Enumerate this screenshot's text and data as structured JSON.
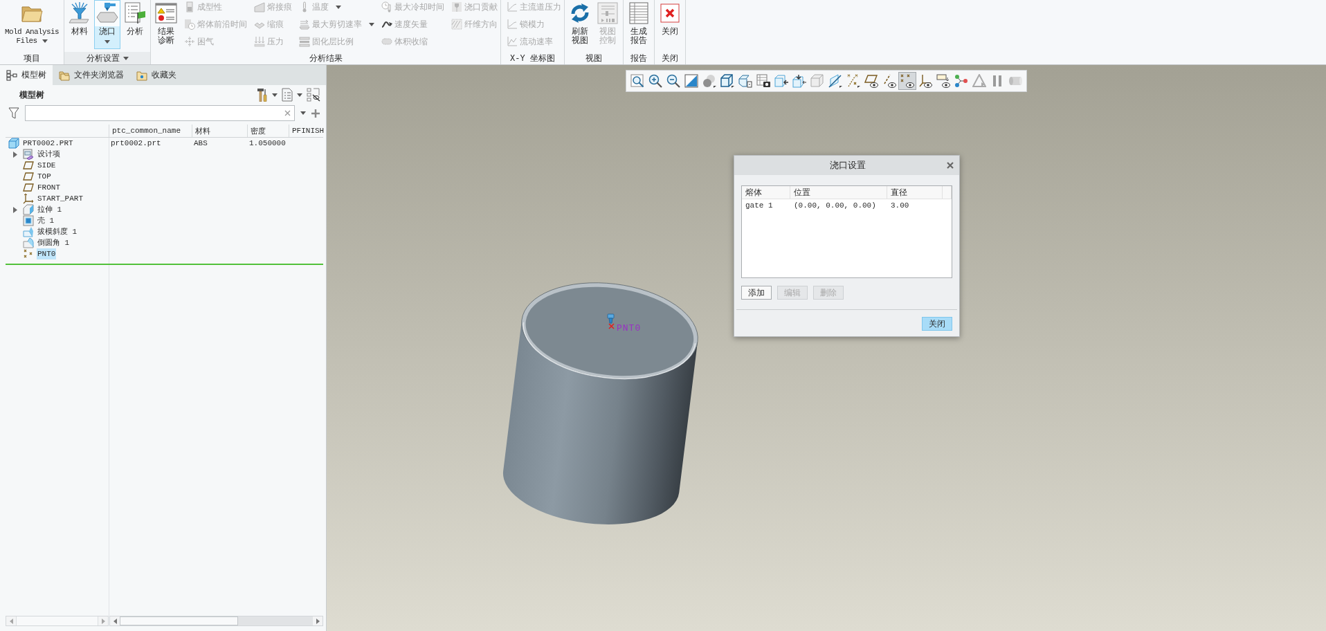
{
  "ribbon": {
    "groups": [
      {
        "label": "项目",
        "menu": false,
        "large": [
          {
            "label": "Mold Analysis Files",
            "menu": true,
            "active": false,
            "disabled": false
          }
        ]
      },
      {
        "label": "分析设置",
        "menu": true,
        "large": [
          {
            "label": "材料",
            "menu": false,
            "active": false,
            "disabled": false
          },
          {
            "label": "浇口",
            "menu": true,
            "active": true,
            "disabled": false
          },
          {
            "label": "分析",
            "menu": false,
            "active": false,
            "disabled": false
          }
        ]
      },
      {
        "label": "分析结果",
        "menu": false,
        "large": [
          {
            "label": "结果诊断",
            "menu": false,
            "active": false,
            "disabled": false
          }
        ],
        "small": [
          {
            "label": "成型性",
            "disabled": true,
            "menu": false
          },
          {
            "label": "熔体前沿时间",
            "disabled": true,
            "menu": false
          },
          {
            "label": "困气",
            "disabled": true,
            "menu": false
          },
          {
            "label": "熔接痕",
            "disabled": true,
            "menu": false
          },
          {
            "label": "缩痕",
            "disabled": true,
            "menu": false
          },
          {
            "label": "压力",
            "disabled": true,
            "menu": false
          },
          {
            "label": "温度",
            "disabled": true,
            "menu": true
          },
          {
            "label": "最大剪切速率",
            "disabled": true,
            "menu": true
          },
          {
            "label": "固化层比例",
            "disabled": true,
            "menu": false
          },
          {
            "label": "最大冷却时间",
            "disabled": true,
            "menu": false
          },
          {
            "label": "速度矢量",
            "disabled": true,
            "menu": false
          },
          {
            "label": "体积收缩",
            "disabled": true,
            "menu": false
          },
          {
            "label": "浇口贡献",
            "disabled": true,
            "menu": false
          },
          {
            "label": "纤维方向",
            "disabled": true,
            "menu": false
          }
        ]
      },
      {
        "label": "X-Y 坐标图",
        "menu": false,
        "small": [
          {
            "label": "主流道压力",
            "disabled": true,
            "menu": false
          },
          {
            "label": "锁模力",
            "disabled": true,
            "menu": false
          },
          {
            "label": "流动速率",
            "disabled": true,
            "menu": false
          }
        ]
      },
      {
        "label": "视图",
        "menu": false,
        "large": [
          {
            "label": "刷新视图",
            "menu": false,
            "active": false,
            "disabled": false
          },
          {
            "label": "视图控制",
            "menu": false,
            "active": false,
            "disabled": true
          }
        ]
      },
      {
        "label": "报告",
        "menu": false,
        "large": [
          {
            "label": "生成报告",
            "menu": false,
            "active": false,
            "disabled": false
          }
        ]
      },
      {
        "label": "关闭",
        "menu": false,
        "large": [
          {
            "label": "关闭",
            "menu": false,
            "active": false,
            "disabled": false
          }
        ]
      }
    ]
  },
  "model_tree": {
    "tabs": [
      {
        "label": "模型树",
        "selected": true
      },
      {
        "label": "文件夹浏览器",
        "selected": false
      },
      {
        "label": "收藏夹",
        "selected": false
      }
    ],
    "title": "模型树",
    "columns": [
      "ptc_common_name",
      "材料",
      "密度",
      "PFINISH"
    ],
    "root": {
      "label": "PRT0002.PRT",
      "kind": "part",
      "collapsed": false,
      "selected": false,
      "cells": [
        "prt0002.prt",
        "ABS",
        "1.050000"
      ],
      "children": [
        {
          "label": "设计项",
          "kind": "group",
          "collapsed": true,
          "selected": false
        },
        {
          "label": "SIDE",
          "kind": "plane",
          "collapsed": false,
          "selected": false
        },
        {
          "label": "TOP",
          "kind": "plane",
          "collapsed": false,
          "selected": false
        },
        {
          "label": "FRONT",
          "kind": "plane",
          "collapsed": false,
          "selected": false
        },
        {
          "label": "START_PART",
          "kind": "csys",
          "collapsed": false,
          "selected": false
        },
        {
          "label": "拉伸 1",
          "kind": "extrude",
          "collapsed": true,
          "selected": false
        },
        {
          "label": "壳 1",
          "kind": "shell",
          "collapsed": false,
          "selected": false
        },
        {
          "label": "拔模斜度 1",
          "kind": "draft",
          "collapsed": false,
          "selected": false
        },
        {
          "label": "倒圆角 1",
          "kind": "round",
          "collapsed": false,
          "selected": false
        },
        {
          "label": "PNT0",
          "kind": "point",
          "collapsed": false,
          "selected": true
        }
      ]
    }
  },
  "viewport": {
    "toolbar": [
      {
        "selected": false
      },
      {
        "selected": false
      },
      {
        "selected": false
      },
      {
        "selected": false
      },
      {
        "selected": false
      },
      {
        "selected": false
      },
      {
        "selected": false
      },
      {
        "selected": false
      },
      {
        "selected": false
      },
      {
        "selected": false
      },
      {
        "selected": false
      },
      {
        "selected": false
      },
      {
        "selected": false
      },
      {
        "selected": false
      },
      {
        "selected": false
      },
      {
        "selected": true
      },
      {
        "selected": false
      },
      {
        "selected": false
      },
      {
        "selected": false
      },
      {
        "selected": false
      },
      {
        "selected": false
      },
      {
        "selected": false
      }
    ],
    "model": {
      "point_label": "PNT0"
    }
  },
  "dialog": {
    "title": "浇口设置",
    "table": {
      "columns": [
        "熔体",
        "位置",
        "直径"
      ],
      "rows": [
        [
          "gate 1",
          "(0.00, 0.00, 0.00)",
          "3.00"
        ]
      ]
    },
    "buttons": [
      {
        "label": "添加",
        "disabled": false
      },
      {
        "label": "编辑",
        "disabled": true
      },
      {
        "label": "删除",
        "disabled": true
      }
    ],
    "close_button": {
      "label": "关闭",
      "default": true
    }
  }
}
